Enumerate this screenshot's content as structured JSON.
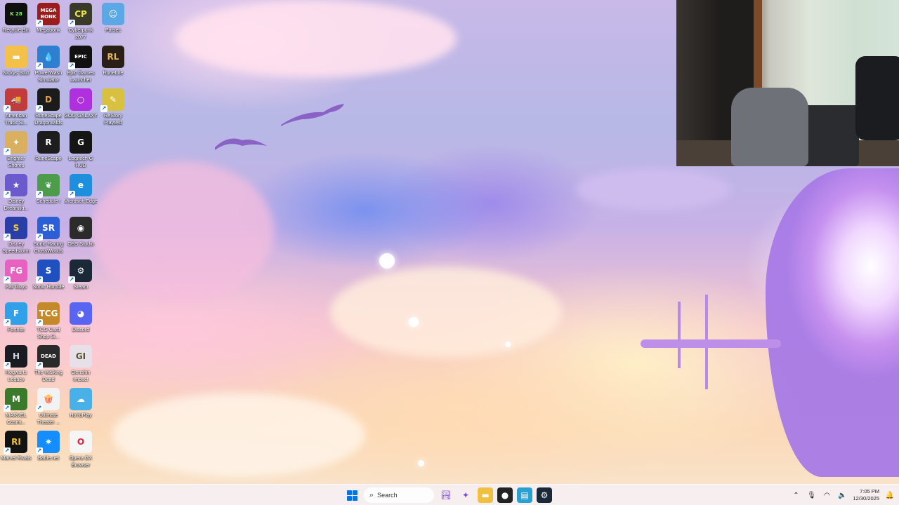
{
  "desktop": {
    "icons": [
      {
        "label": "Recycle Bin",
        "glyph": "K 28",
        "color": "#0f0f0f",
        "fg": "#7cf25c",
        "icon": "recycle-bin-icon",
        "shortcut": false
      },
      {
        "label": "Megabonk",
        "glyph": "MEGA BONK",
        "color": "#9b1c1c",
        "fg": "#fff",
        "icon": "megabonk-icon",
        "shortcut": true
      },
      {
        "label": "Cyberpunk 2077",
        "glyph": "CP",
        "color": "#3a3a2a",
        "fg": "#e8e54a",
        "icon": "cyberpunk-icon",
        "shortcut": true
      },
      {
        "label": "Parsec",
        "glyph": "☺",
        "color": "#5aa9e6",
        "fg": "#fff",
        "icon": "parsec-icon",
        "shortcut": false
      },
      {
        "label": "Nickys Stuff",
        "glyph": "▬",
        "color": "#f3c14a",
        "fg": "#fff",
        "icon": "folder-icon",
        "shortcut": false
      },
      {
        "label": "PowerWash Simulator",
        "glyph": "💧",
        "color": "#2f7fd0",
        "fg": "#fff",
        "icon": "powerwash-icon",
        "shortcut": true
      },
      {
        "label": "Epic Games Launcher",
        "glyph": "EPIC",
        "color": "#111",
        "fg": "#fff",
        "icon": "epic-games-icon",
        "shortcut": true
      },
      {
        "label": "RuneLite",
        "glyph": "RL",
        "color": "#2a1f17",
        "fg": "#e0b55e",
        "icon": "runelite-icon",
        "shortcut": false
      },
      {
        "label": "American Truck Si...",
        "glyph": "🚚",
        "color": "#c23c3c",
        "fg": "#fff",
        "icon": "american-truck-icon",
        "shortcut": true
      },
      {
        "label": "RuneScape Dragonwilds",
        "glyph": "D",
        "color": "#1b1b1b",
        "fg": "#e0a24a",
        "icon": "dragonwilds-icon",
        "shortcut": true
      },
      {
        "label": "GOG GALAXY",
        "glyph": "○",
        "color": "#b030e0",
        "fg": "#fff",
        "icon": "gog-galaxy-icon",
        "shortcut": false
      },
      {
        "label": "ReStory Playtest",
        "glyph": "✎",
        "color": "#d8c040",
        "fg": "#fff",
        "icon": "restory-icon",
        "shortcut": true
      },
      {
        "label": "Brighter Shores",
        "glyph": "✦",
        "color": "#d8b060",
        "fg": "#fff",
        "icon": "brighter-shores-icon",
        "shortcut": true
      },
      {
        "label": "RuneScape",
        "glyph": "R",
        "color": "#1d1d1d",
        "fg": "#fff",
        "icon": "runescape-icon",
        "shortcut": false
      },
      {
        "label": "Logitech G HUB",
        "glyph": "G",
        "color": "#151515",
        "fg": "#fff",
        "icon": "logitech-icon",
        "shortcut": false
      },
      {
        "label": "",
        "glyph": "",
        "color": "transparent",
        "fg": "#fff",
        "icon": "empty-slot",
        "shortcut": false
      },
      {
        "label": "Disney Dreamlig...",
        "glyph": "★",
        "color": "#6a5acd",
        "fg": "#fff",
        "icon": "dreamlight-icon",
        "shortcut": true
      },
      {
        "label": "Schedule I",
        "glyph": "❦",
        "color": "#4c9c4c",
        "fg": "#fff",
        "icon": "schedule-i-icon",
        "shortcut": true
      },
      {
        "label": "Microsoft Edge",
        "glyph": "e",
        "color": "#1d8fdc",
        "fg": "#fff",
        "icon": "edge-icon",
        "shortcut": true
      },
      {
        "label": "",
        "glyph": "",
        "color": "transparent",
        "fg": "#fff",
        "icon": "empty-slot",
        "shortcut": false
      },
      {
        "label": "Disney Speedstorm",
        "glyph": "S",
        "color": "#2a3ea8",
        "fg": "#f0d040",
        "icon": "speedstorm-icon",
        "shortcut": true
      },
      {
        "label": "Sonic Racing CrossWorlds",
        "glyph": "SR",
        "color": "#2c5fd6",
        "fg": "#fff",
        "icon": "sonic-racing-icon",
        "shortcut": true
      },
      {
        "label": "OBS Studio",
        "glyph": "◉",
        "color": "#2b2b2b",
        "fg": "#fff",
        "icon": "obs-icon",
        "shortcut": false
      },
      {
        "label": "",
        "glyph": "",
        "color": "transparent",
        "fg": "#fff",
        "icon": "empty-slot",
        "shortcut": false
      },
      {
        "label": "Fall Guys",
        "glyph": "FG",
        "color": "#e860c0",
        "fg": "#fff",
        "icon": "fall-guys-icon",
        "shortcut": true
      },
      {
        "label": "Sonic Rumble",
        "glyph": "S",
        "color": "#2050c0",
        "fg": "#fff",
        "icon": "sonic-rumble-icon",
        "shortcut": true
      },
      {
        "label": "Steam",
        "glyph": "⚙",
        "color": "#1b2838",
        "fg": "#fff",
        "icon": "steam-icon",
        "shortcut": true
      },
      {
        "label": "",
        "glyph": "",
        "color": "transparent",
        "fg": "#fff",
        "icon": "empty-slot",
        "shortcut": false
      },
      {
        "label": "Fortnite",
        "glyph": "F",
        "color": "#30a0e8",
        "fg": "#fff",
        "icon": "fortnite-icon",
        "shortcut": true
      },
      {
        "label": "TCG Card Shop Si...",
        "glyph": "TCG",
        "color": "#c48a2a",
        "fg": "#fff",
        "icon": "tcg-card-shop-icon",
        "shortcut": true
      },
      {
        "label": "Discord",
        "glyph": "◕",
        "color": "#5865f2",
        "fg": "#fff",
        "icon": "discord-icon",
        "shortcut": false
      },
      {
        "label": "",
        "glyph": "",
        "color": "transparent",
        "fg": "#fff",
        "icon": "empty-slot",
        "shortcut": false
      },
      {
        "label": "Hogwarts Legacy",
        "glyph": "H",
        "color": "#1a1a22",
        "fg": "#cfd8e0",
        "icon": "hogwarts-icon",
        "shortcut": true
      },
      {
        "label": "The Walking Dead",
        "glyph": "DEAD",
        "color": "#2a2a2a",
        "fg": "#fff",
        "icon": "walking-dead-icon",
        "shortcut": true
      },
      {
        "label": "Genshin Impact",
        "glyph": "GI",
        "color": "#e8e0e8",
        "fg": "#553",
        "icon": "genshin-icon",
        "shortcut": false
      },
      {
        "label": "",
        "glyph": "",
        "color": "transparent",
        "fg": "#fff",
        "icon": "empty-slot",
        "shortcut": false
      },
      {
        "label": "MARVEL Cosmi...",
        "glyph": "M",
        "color": "#3a7a2a",
        "fg": "#fff",
        "icon": "marvel-cosmic-icon",
        "shortcut": true
      },
      {
        "label": "Ultimate Theater ...",
        "glyph": "🍿",
        "color": "#f2f2f2",
        "fg": "#c22",
        "icon": "theater-icon",
        "shortcut": true
      },
      {
        "label": "HoYoPlay",
        "glyph": "☁",
        "color": "#4ab0e8",
        "fg": "#fff",
        "icon": "hoyoplay-icon",
        "shortcut": false
      },
      {
        "label": "",
        "glyph": "",
        "color": "transparent",
        "fg": "#fff",
        "icon": "empty-slot",
        "shortcut": false
      },
      {
        "label": "Marvel Rivals",
        "glyph": "RI",
        "color": "#121212",
        "fg": "#f0c030",
        "icon": "marvel-rivals-icon",
        "shortcut": true
      },
      {
        "label": "Battle.net",
        "glyph": "✷",
        "color": "#148eff",
        "fg": "#fff",
        "icon": "battlenet-icon",
        "shortcut": true
      },
      {
        "label": "Opera GX Browser",
        "glyph": "O",
        "color": "#f5f5f5",
        "fg": "#e0203a",
        "icon": "opera-gx-icon",
        "shortcut": false
      },
      {
        "label": "",
        "glyph": "",
        "color": "transparent",
        "fg": "#fff",
        "icon": "empty-slot",
        "shortcut": false
      }
    ]
  },
  "taskbar": {
    "search_label": "Search",
    "apps": [
      {
        "name": "widgets-icon",
        "glyph": "🏞",
        "color": "transparent"
      },
      {
        "name": "copilot-icon",
        "glyph": "✦",
        "color": "transparent"
      },
      {
        "name": "file-explorer-icon",
        "glyph": "▬",
        "color": "#f2c040"
      },
      {
        "name": "app-badge-icon",
        "glyph": "●",
        "color": "#222"
      },
      {
        "name": "notepad-icon",
        "glyph": "▤",
        "color": "#2aa0d0"
      },
      {
        "name": "steam-taskbar-icon",
        "glyph": "⚙",
        "color": "#1b2838"
      }
    ],
    "time": "7:05 PM",
    "date": "12/30/2025",
    "accent": "#0a74da"
  }
}
